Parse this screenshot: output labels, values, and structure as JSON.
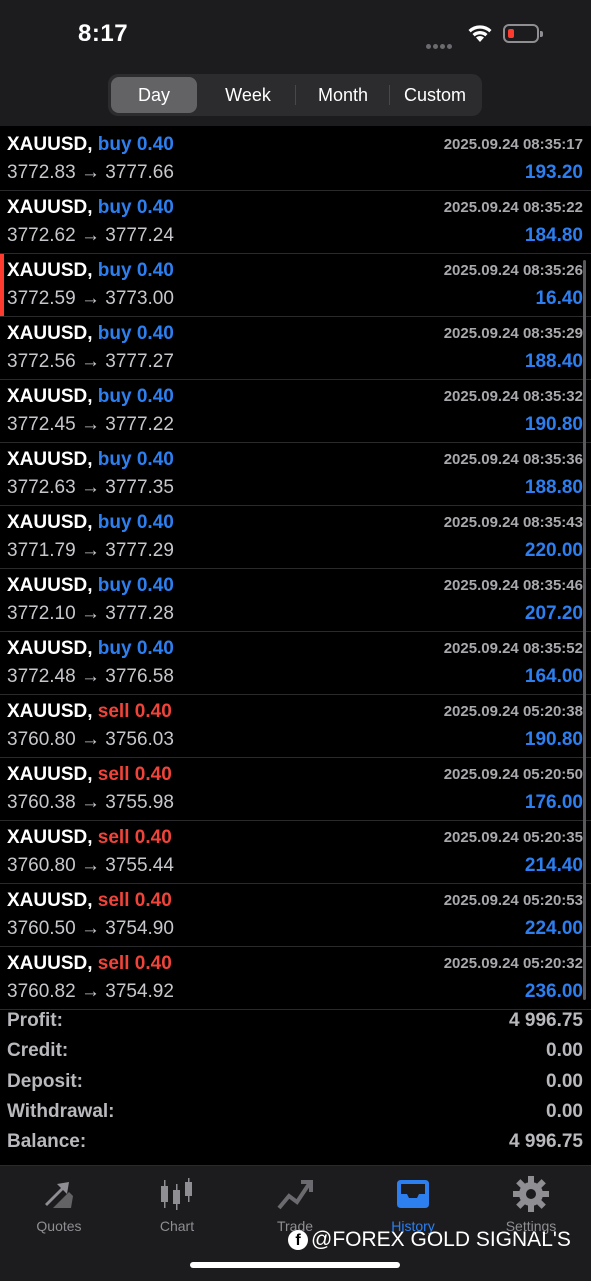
{
  "status": {
    "time": "8:17"
  },
  "tabs_period": [
    "Day",
    "Week",
    "Month",
    "Custom"
  ],
  "trades": [
    {
      "symbol": "XAUUSD,",
      "side": "buy",
      "lot": "0.40",
      "open": "3772.83",
      "close": "3777.66",
      "time": "2025.09.24 08:35:17",
      "profit": "193.20"
    },
    {
      "symbol": "XAUUSD,",
      "side": "buy",
      "lot": "0.40",
      "open": "3772.62",
      "close": "3777.24",
      "time": "2025.09.24 08:35:22",
      "profit": "184.80"
    },
    {
      "symbol": "XAUUSD,",
      "side": "buy",
      "lot": "0.40",
      "open": "3772.59",
      "close": "3773.00",
      "time": "2025.09.24 08:35:26",
      "profit": "16.40"
    },
    {
      "symbol": "XAUUSD,",
      "side": "buy",
      "lot": "0.40",
      "open": "3772.56",
      "close": "3777.27",
      "time": "2025.09.24 08:35:29",
      "profit": "188.40"
    },
    {
      "symbol": "XAUUSD,",
      "side": "buy",
      "lot": "0.40",
      "open": "3772.45",
      "close": "3777.22",
      "time": "2025.09.24 08:35:32",
      "profit": "190.80"
    },
    {
      "symbol": "XAUUSD,",
      "side": "buy",
      "lot": "0.40",
      "open": "3772.63",
      "close": "3777.35",
      "time": "2025.09.24 08:35:36",
      "profit": "188.80"
    },
    {
      "symbol": "XAUUSD,",
      "side": "buy",
      "lot": "0.40",
      "open": "3771.79",
      "close": "3777.29",
      "time": "2025.09.24 08:35:43",
      "profit": "220.00"
    },
    {
      "symbol": "XAUUSD,",
      "side": "buy",
      "lot": "0.40",
      "open": "3772.10",
      "close": "3777.28",
      "time": "2025.09.24 08:35:46",
      "profit": "207.20"
    },
    {
      "symbol": "XAUUSD,",
      "side": "buy",
      "lot": "0.40",
      "open": "3772.48",
      "close": "3776.58",
      "time": "2025.09.24 08:35:52",
      "profit": "164.00"
    },
    {
      "symbol": "XAUUSD,",
      "side": "sell",
      "lot": "0.40",
      "open": "3760.80",
      "close": "3756.03",
      "time": "2025.09.24 05:20:38",
      "profit": "190.80"
    },
    {
      "symbol": "XAUUSD,",
      "side": "sell",
      "lot": "0.40",
      "open": "3760.38",
      "close": "3755.98",
      "time": "2025.09.24 05:20:50",
      "profit": "176.00"
    },
    {
      "symbol": "XAUUSD,",
      "side": "sell",
      "lot": "0.40",
      "open": "3760.80",
      "close": "3755.44",
      "time": "2025.09.24 05:20:35",
      "profit": "214.40"
    },
    {
      "symbol": "XAUUSD,",
      "side": "sell",
      "lot": "0.40",
      "open": "3760.50",
      "close": "3754.90",
      "time": "2025.09.24 05:20:53",
      "profit": "224.00"
    },
    {
      "symbol": "XAUUSD,",
      "side": "sell",
      "lot": "0.40",
      "open": "3760.82",
      "close": "3754.92",
      "time": "2025.09.24 05:20:32",
      "profit": "236.00"
    }
  ],
  "arrow": "→",
  "summary": [
    {
      "label": "Profit:",
      "value": "4 996.75"
    },
    {
      "label": "Credit:",
      "value": "0.00"
    },
    {
      "label": "Deposit:",
      "value": "0.00"
    },
    {
      "label": "Withdrawal:",
      "value": "0.00"
    },
    {
      "label": "Balance:",
      "value": "4 996.75"
    }
  ],
  "tabbar": [
    {
      "label": "Quotes",
      "icon": "quotes-icon"
    },
    {
      "label": "Chart",
      "icon": "chart-icon"
    },
    {
      "label": "Trade",
      "icon": "trade-icon"
    },
    {
      "label": "History",
      "icon": "history-icon"
    },
    {
      "label": "Settings",
      "icon": "settings-icon"
    }
  ],
  "watermark": "@FOREX GOLD SIGNAL'S",
  "colors": {
    "buy": "#2d7ff0",
    "sell": "#f0443a",
    "active_tab": "#2d7ff0",
    "battery_low": "#ff3b30"
  }
}
